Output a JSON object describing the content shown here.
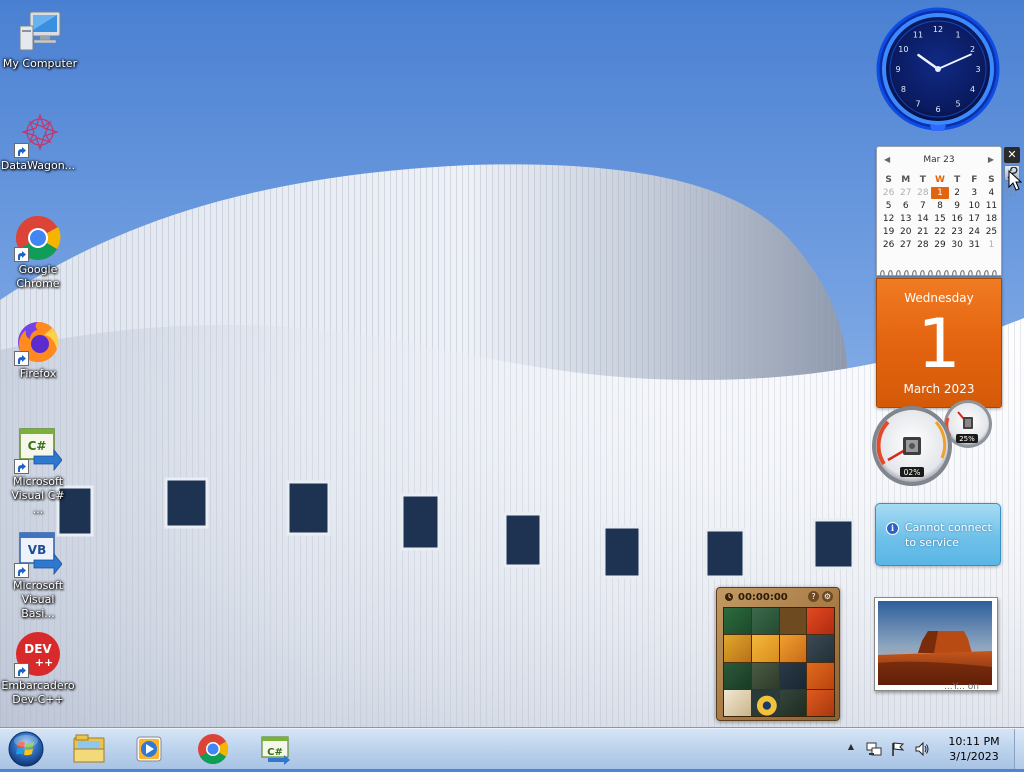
{
  "desktop": {
    "icons": [
      {
        "label": "My Computer",
        "icon": "computer-icon"
      },
      {
        "label": "DataWagon...",
        "icon": "datawagon-icon"
      },
      {
        "label": "Google Chrome",
        "icon": "chrome-icon"
      },
      {
        "label": "Firefox",
        "icon": "firefox-icon"
      },
      {
        "label": "Microsoft Visual C# ...",
        "icon": "visual-csharp-icon"
      },
      {
        "label": "Microsoft Visual Basi...",
        "icon": "visual-basic-icon"
      },
      {
        "label": "Embarcadero Dev-C++",
        "icon": "devcpp-icon"
      }
    ],
    "icon_glyphs": {
      "csharp": "C#",
      "vb": "VB",
      "dev": "DEV",
      "devplus": "++"
    }
  },
  "clock_gadget": {
    "numerals": [
      "12",
      "1",
      "2",
      "3",
      "4",
      "5",
      "6",
      "7",
      "8",
      "9",
      "10",
      "11"
    ],
    "time": {
      "hour": 10,
      "minute": 11
    }
  },
  "calendar_gadget": {
    "month_header": "Mar 23",
    "prev_glyph": "◀",
    "next_glyph": "▶",
    "weekdays": [
      "S",
      "M",
      "T",
      "W",
      "T",
      "F",
      "S"
    ],
    "weeks": [
      [
        "26",
        "27",
        "28",
        "1",
        "2",
        "3",
        "4"
      ],
      [
        "5",
        "6",
        "7",
        "8",
        "9",
        "10",
        "11"
      ],
      [
        "12",
        "13",
        "14",
        "15",
        "16",
        "17",
        "18"
      ],
      [
        "19",
        "20",
        "21",
        "22",
        "23",
        "24",
        "25"
      ],
      [
        "26",
        "27",
        "28",
        "29",
        "30",
        "31",
        "1"
      ]
    ],
    "today": "1",
    "day_name": "Wednesday",
    "day_number": "1",
    "month_year": "March 2023"
  },
  "cpu_gadget": {
    "cpu_percent": "02%",
    "memory_percent": "25%",
    "cpu_level": 0.02,
    "memory_level": 0.25
  },
  "weather_gadget": {
    "message": "Cannot connect to service",
    "info_glyph": "i"
  },
  "puzzle_gadget": {
    "timer": "00:00:00",
    "help_glyph": "?",
    "options_glyph": "⚙"
  },
  "photo_gadget": {
    "caption": "...Y... on"
  },
  "gadget_toolbar": {
    "close_glyph": "✕"
  },
  "taskbar": {
    "apps": [
      "windows-explorer",
      "windows-media-player",
      "google-chrome",
      "visual-csharp"
    ],
    "csharp_glyph": "C#",
    "tray_expand_glyph": "▲"
  },
  "clock": {
    "time": "10:11 PM",
    "date": "3/1/2023"
  },
  "colors": {
    "accent_orange": "#e4640e",
    "clock_blue": "#1a5ae8",
    "taskbar": "#bed4ee"
  }
}
